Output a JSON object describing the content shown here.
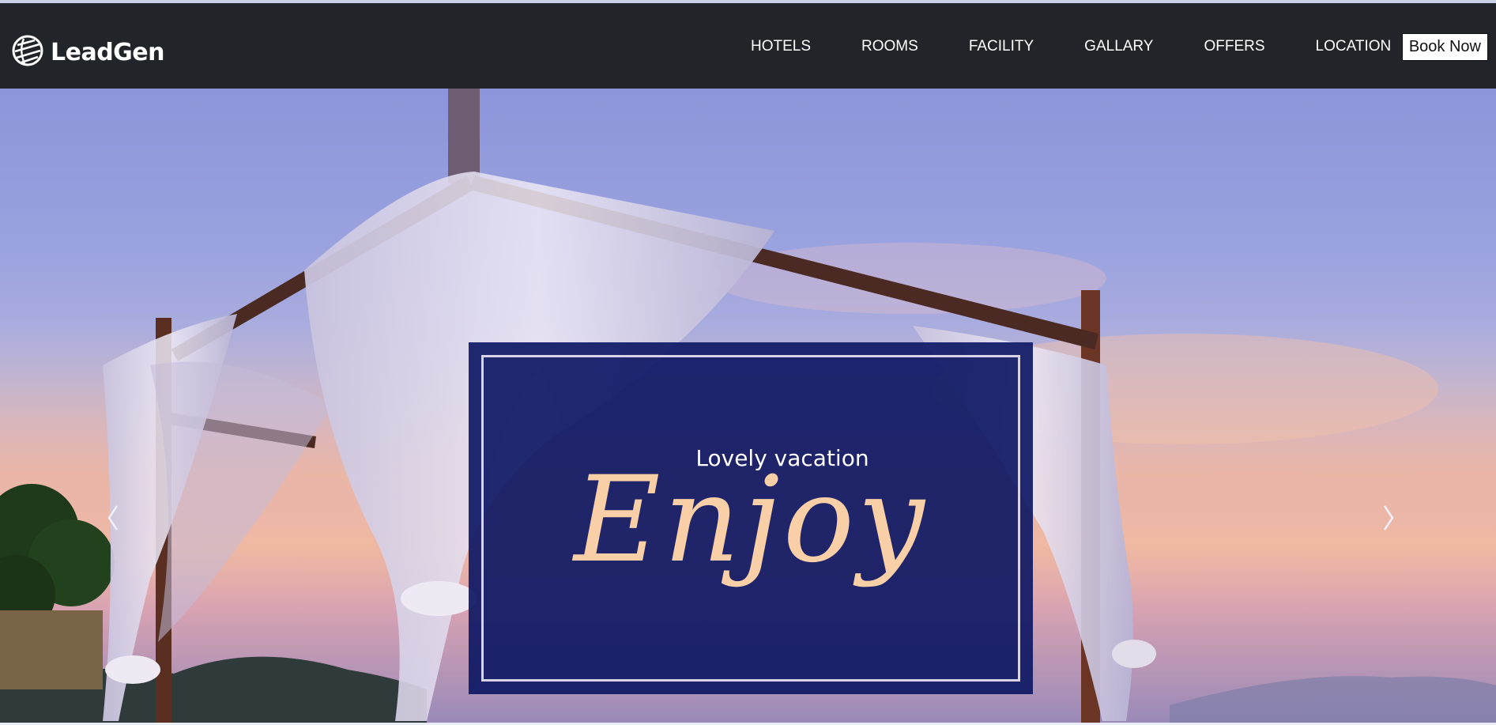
{
  "brand": {
    "name": "LeadGen",
    "logo_icon": "globe-logo-icon"
  },
  "nav": {
    "items": [
      "HOTELS",
      "ROOMS",
      "FACILITY",
      "GALLARY",
      "OFFERS",
      "LOCATION"
    ],
    "book_label": "Book Now"
  },
  "hero": {
    "subtitle": "Lovely vacation",
    "headline": "Enjoy",
    "prev_icon": "chevron-left-icon",
    "next_icon": "chevron-right-icon"
  },
  "colors": {
    "navbar": "#212529",
    "card": "#0e1864",
    "script": "#f8cfa6"
  }
}
